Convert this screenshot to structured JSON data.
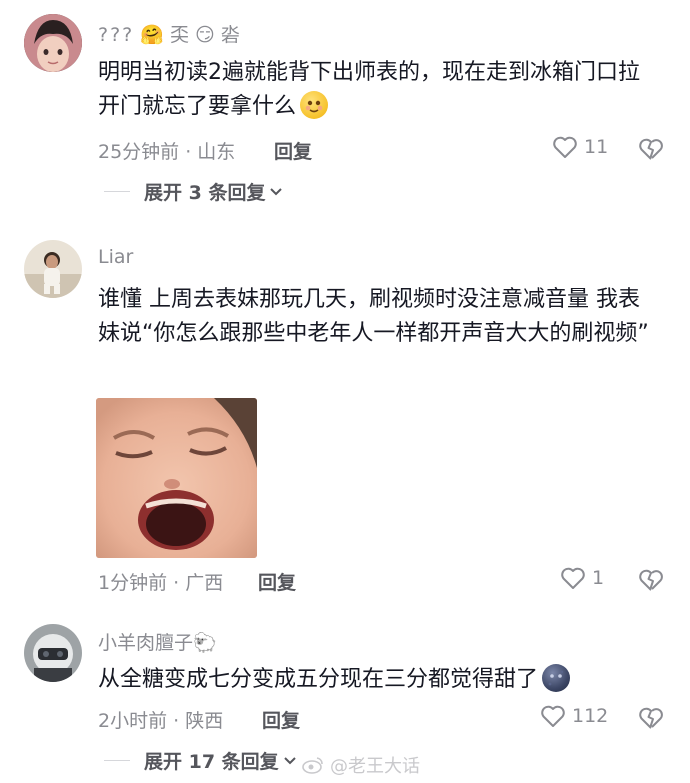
{
  "comments": [
    {
      "username": "???",
      "username_suffix": "🤗 奀 😏 沯",
      "text": "明明当初读2遍就能背下出师表的，现在走到冰箱门口拉开门就忘了要拿什么",
      "time_location": "25分钟前 · 山东",
      "reply_label": "回复",
      "likes": "11",
      "expand_label": "展开 3 条回复"
    },
    {
      "username": "Liar",
      "text": "谁懂 上周去表妹那玩几天，刷视频时没注意减音量 我表妹说“你怎么跟那些中老年人一样都开声音大大的刷视频”",
      "time_location": "1分钟前 · 广西",
      "reply_label": "回复",
      "likes": "1"
    },
    {
      "username": "小羊肉膻子🐑",
      "text": "从全糖变成七分变成五分现在三分都觉得甜了",
      "time_location": "2小时前 · 陕西",
      "reply_label": "回复",
      "likes": "112",
      "expand_label": "展开 17 条回复"
    }
  ],
  "watermark": "@老王大话",
  "icons": {
    "like": "heart-outline-icon",
    "dislike": "broken-heart-icon",
    "expand": "chevron-down-icon"
  },
  "colors": {
    "text": "#161823",
    "muted": "#8a8b91",
    "action": "#55565c"
  }
}
